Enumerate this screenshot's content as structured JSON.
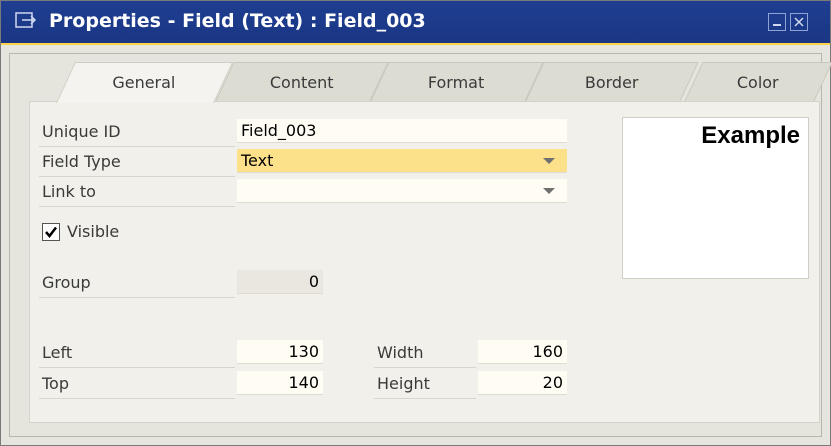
{
  "window": {
    "title": "Properties - Field (Text) : Field_003"
  },
  "tabs": [
    {
      "label": "General",
      "active": true
    },
    {
      "label": "Content",
      "active": false
    },
    {
      "label": "Format",
      "active": false
    },
    {
      "label": "Border",
      "active": false
    },
    {
      "label": "Color",
      "active": false
    }
  ],
  "general": {
    "unique_id": {
      "label": "Unique ID",
      "value": "Field_003"
    },
    "field_type": {
      "label": "Field Type",
      "value": "Text"
    },
    "link_to": {
      "label": "Link to",
      "value": ""
    },
    "visible": {
      "label": "Visible",
      "checked": true
    },
    "group": {
      "label": "Group",
      "value": "0"
    },
    "left": {
      "label": "Left",
      "value": "130"
    },
    "top": {
      "label": "Top",
      "value": "140"
    },
    "width": {
      "label": "Width",
      "value": "160"
    },
    "height": {
      "label": "Height",
      "value": "20"
    }
  },
  "example": {
    "text": "Example"
  },
  "icons": {
    "title": "properties-icon",
    "minimize": "minimize-icon",
    "close": "close-icon",
    "dropdown": "chevron-down-icon",
    "check": "check-icon"
  },
  "colors": {
    "titlebar": "#1f3e91",
    "title_accent": "#ffd24a",
    "highlight_field": "#fde18a"
  }
}
